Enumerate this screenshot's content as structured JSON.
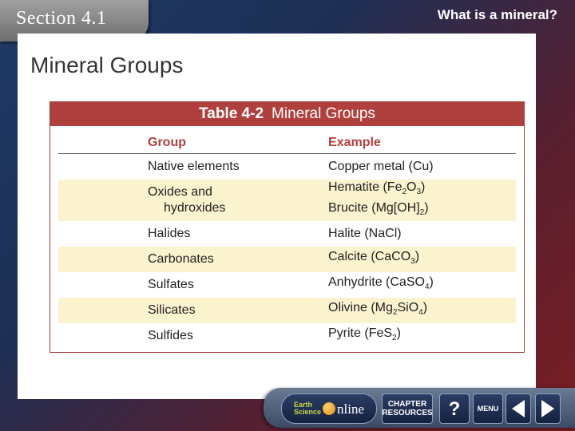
{
  "header": {
    "section_label": "Section 4.1",
    "top_title": "What is a mineral?"
  },
  "page_title": "Mineral Groups",
  "table": {
    "number": "Table 4-2",
    "name": "Mineral Groups",
    "col_group": "Group",
    "col_example": "Example",
    "rows": [
      {
        "group": "Native elements",
        "example": "Copper metal (Cu)"
      },
      {
        "group_line1": "Oxides and",
        "group_line2": "hydroxides",
        "example_line1_pre": "Hematite (Fe",
        "example_line1_sub1": "2",
        "example_line1_mid": "O",
        "example_line1_sub2": "3",
        "example_line1_post": ")",
        "example_line2_pre": "Brucite (Mg[OH]",
        "example_line2_sub": "2",
        "example_line2_post": ")"
      },
      {
        "group": "Halides",
        "example": "Halite (NaCl)"
      },
      {
        "group": "Carbonates",
        "example_pre": "Calcite (CaCO",
        "example_sub": "3",
        "example_post": ")"
      },
      {
        "group": "Sulfates",
        "example_pre": "Anhydrite (CaSO",
        "example_sub": "4",
        "example_post": ")"
      },
      {
        "group": "Silicates",
        "example_pre": "Olivine (Mg",
        "example_sub1": "2",
        "example_mid": "SiO",
        "example_sub2": "4",
        "example_post": ")"
      },
      {
        "group": "Sulfides",
        "example_pre": "Pyrite (FeS",
        "example_sub": "2",
        "example_post": ")"
      }
    ]
  },
  "nav": {
    "earth_line1": "Earth",
    "earth_line2": "Science",
    "online": "nline",
    "chapter_line1": "CHAPTER",
    "chapter_line2": "RESOURCES",
    "help": "?",
    "menu": "MENU"
  }
}
